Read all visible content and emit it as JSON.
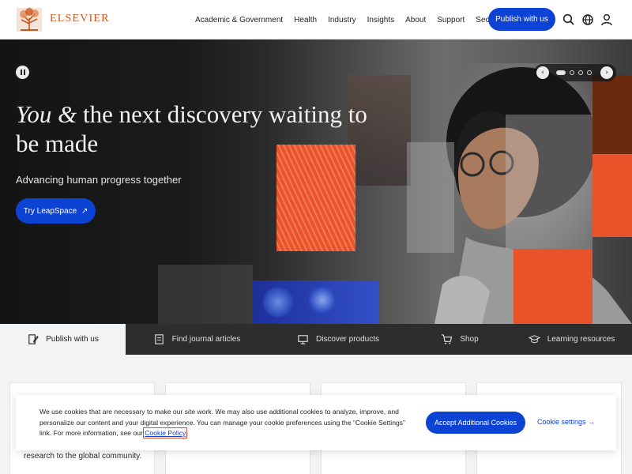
{
  "header": {
    "brand": "ELSEVIER",
    "nav": [
      "Academic & Government",
      "Health",
      "Industry",
      "Insights",
      "About",
      "Support",
      "Security"
    ],
    "publish_label": "Publish with us",
    "icons": [
      "search-icon",
      "globe-icon",
      "user-icon"
    ]
  },
  "hero": {
    "title_em": "You &",
    "title_rest": " the next discovery waiting to be made",
    "subtitle": "Advancing human progress together",
    "cta_label": "Try LeapSpace",
    "cta_arrow": "↗",
    "carousel": {
      "prev": "‹",
      "next": "›",
      "slides": 4,
      "active_slide": 1
    }
  },
  "tabs": [
    {
      "label": "Publish with us",
      "icon": "publish-icon"
    },
    {
      "label": "Find journal articles",
      "icon": "journal-icon"
    },
    {
      "label": "Discover products",
      "icon": "monitor-icon"
    },
    {
      "label": "Shop",
      "icon": "cart-icon"
    },
    {
      "label": "Learning resources",
      "icon": "graduation-cap-icon"
    }
  ],
  "cards": {
    "first_card_text": "research to the global community."
  },
  "cookie": {
    "text": "We use cookies that are necessary to make our site work. We may also use additional cookies to analyze, improve, and personalize our content and your digital experience. You can manage your cookie preferences using the “Cookie Settings” link. For more information, see our ",
    "policy_link": "Cookie Policy",
    "policy_suffix": ".",
    "accept_label": "Accept Additional Cookies",
    "settings_label": "Cookie settings",
    "settings_arrow": "→"
  },
  "colors": {
    "accent": "#0d43d4",
    "brand": "#d0551c",
    "tab_bar": "#2d2d2d",
    "hero_orange": "#e8532a"
  }
}
